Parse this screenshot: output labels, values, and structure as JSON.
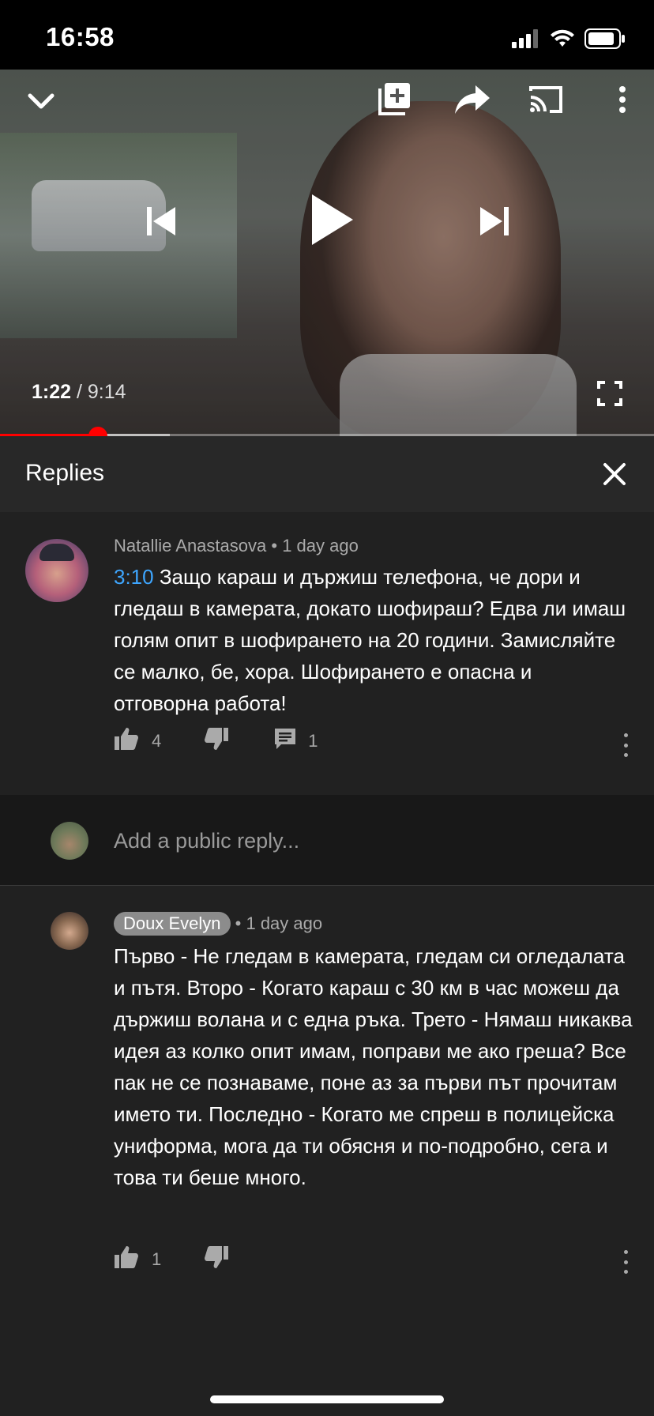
{
  "status_bar": {
    "time": "16:58"
  },
  "player": {
    "current_time": "1:22",
    "separator": "/",
    "duration": "9:14",
    "progress_fraction": 0.15,
    "buffer_fraction": 0.26,
    "icons": {
      "collapse": "chevron-down-icon",
      "add_to_playlist": "playlist-add-icon",
      "share": "share-icon",
      "cast": "cast-icon",
      "more": "more-vert-icon",
      "previous": "skip-previous-icon",
      "play": "play-icon",
      "next": "skip-next-icon",
      "fullscreen": "fullscreen-icon"
    }
  },
  "replies_panel": {
    "title": "Replies",
    "parent_comment": {
      "author": "Natallie Anastasova",
      "dot": "•",
      "age": "1 day ago",
      "timestamp_link": "3:10",
      "text": "Защо караш и държиш телефона, че дори и гледаш в камерата, докато шофираш? Едва ли имаш голям опит в шофирането на 20 години. Замисляйте се малко, бе, хора. Шофирането е опасна и отговорна работа!",
      "likes": "4",
      "replies_count": "1"
    },
    "reply_input": {
      "placeholder": "Add a public reply..."
    },
    "replies": [
      {
        "author": "Doux Evelyn",
        "dot": "•",
        "age": "1 day ago",
        "text": "Първо - Не гледам в камерата, гледам си огледалата и пътя. Второ - Когато караш с 30 км в час можеш да държиш волана и с една ръка. Трето - Нямаш никаква идея аз колко опит имам, поправи ме ако греша? Все пак не се познаваме, поне аз за първи път прочитам името ти. Последно - Когато ме спреш в полицейска униформа, мога да ти обясня и по-подробно, сега и това ти беше много.",
        "likes": "1"
      }
    ]
  },
  "colors": {
    "background": "#212121",
    "header": "#282828",
    "accent_red": "#ff0000",
    "link_blue": "#3ea6ff",
    "secondary_text": "#aaaaaa"
  }
}
